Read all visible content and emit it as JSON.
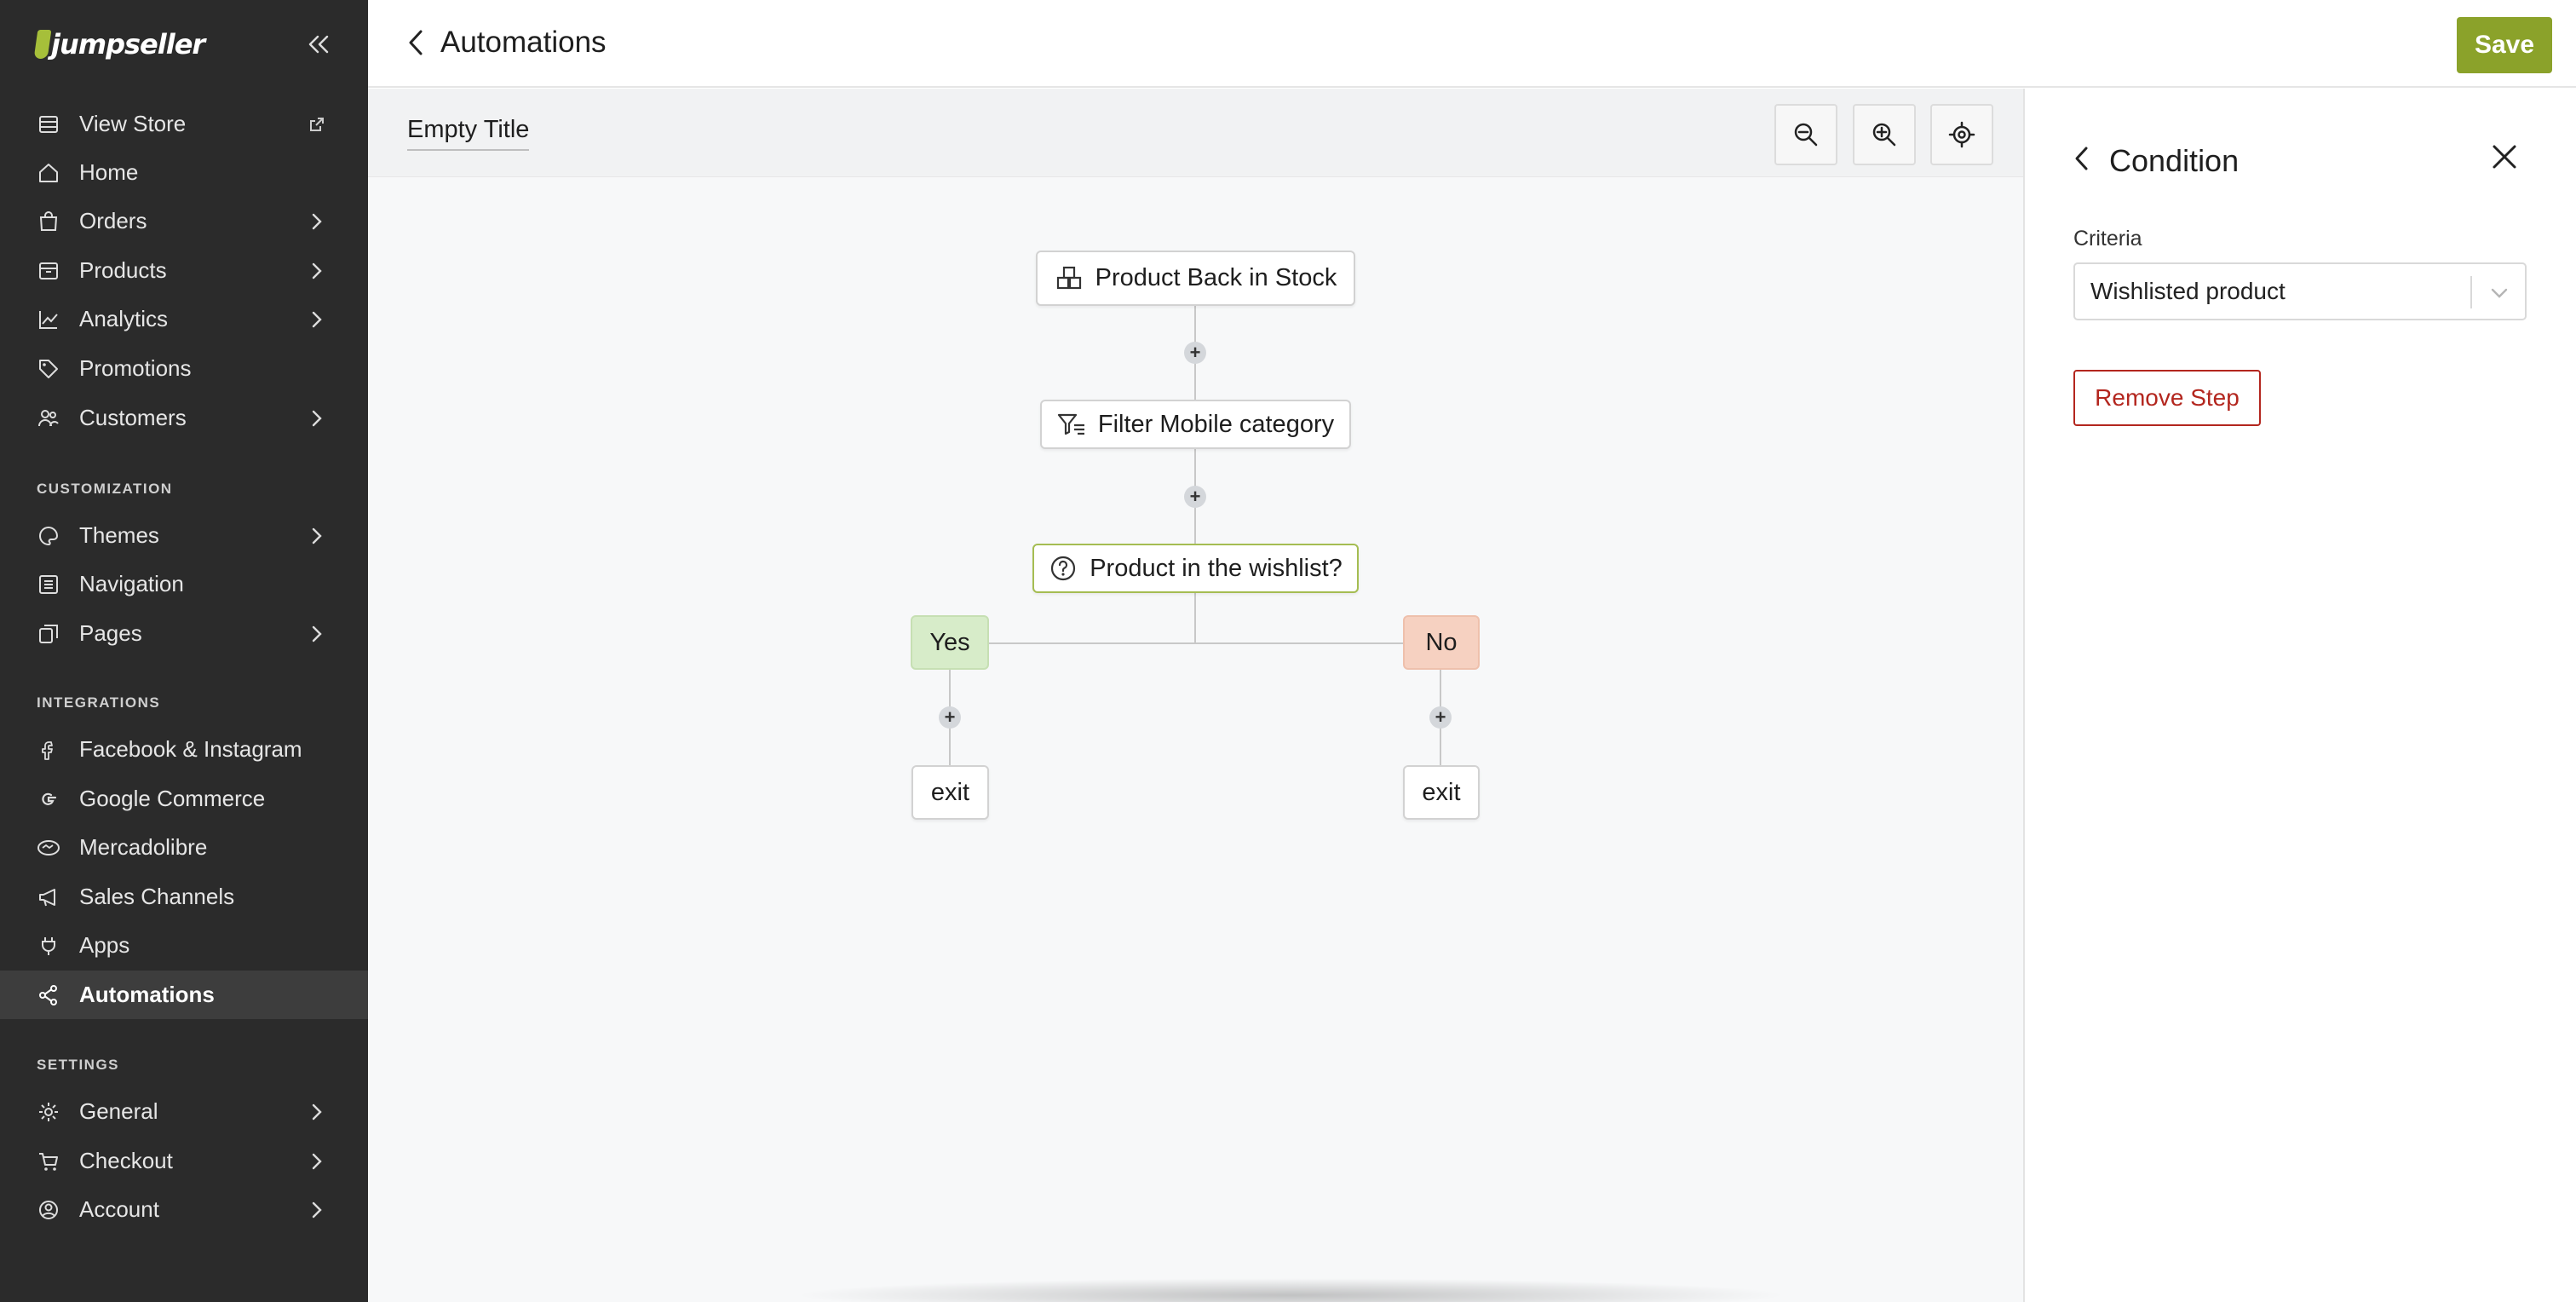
{
  "app": {
    "logo_text": "jumpseller"
  },
  "sidebar": {
    "items": [
      {
        "label": "View Store",
        "icon": "store-icon",
        "external": true
      },
      {
        "label": "Home",
        "icon": "home-icon"
      },
      {
        "label": "Orders",
        "icon": "bag-icon",
        "expandable": true
      },
      {
        "label": "Products",
        "icon": "box-icon",
        "expandable": true
      },
      {
        "label": "Analytics",
        "icon": "chart-icon",
        "expandable": true
      },
      {
        "label": "Promotions",
        "icon": "tag-icon"
      },
      {
        "label": "Customers",
        "icon": "users-icon",
        "expandable": true
      }
    ],
    "customization_label": "CUSTOMIZATION",
    "customization_items": [
      {
        "label": "Themes",
        "icon": "palette-icon",
        "expandable": true
      },
      {
        "label": "Navigation",
        "icon": "list-icon"
      },
      {
        "label": "Pages",
        "icon": "pages-icon",
        "expandable": true
      }
    ],
    "integrations_label": "INTEGRATIONS",
    "integrations_items": [
      {
        "label": "Facebook & Instagram",
        "icon": "facebook-icon"
      },
      {
        "label": "Google Commerce",
        "icon": "google-icon"
      },
      {
        "label": "Mercadolibre",
        "icon": "handshake-icon"
      },
      {
        "label": "Sales Channels",
        "icon": "megaphone-icon"
      },
      {
        "label": "Apps",
        "icon": "plug-icon"
      },
      {
        "label": "Automations",
        "icon": "share-icon",
        "active": true
      }
    ],
    "settings_label": "SETTINGS",
    "settings_items": [
      {
        "label": "General",
        "icon": "gear-icon",
        "expandable": true
      },
      {
        "label": "Checkout",
        "icon": "cart-icon",
        "expandable": true
      },
      {
        "label": "Account",
        "icon": "user-circle-icon",
        "expandable": true
      }
    ]
  },
  "header": {
    "title": "Automations",
    "save_label": "Save",
    "save_color": "#8ba22a"
  },
  "flow": {
    "title": "Empty Title",
    "nodes": {
      "trigger": "Product Back in Stock",
      "filter": "Filter Mobile category",
      "condition": "Product in the wishlist?",
      "yes": "Yes",
      "no": "No",
      "exit_yes": "exit",
      "exit_no": "exit"
    },
    "add_step_symbol": "+"
  },
  "panel": {
    "title": "Condition",
    "criteria_label": "Criteria",
    "criteria_value": "Wishlisted product",
    "remove_label": "Remove Step",
    "remove_color": "#b3261e"
  }
}
